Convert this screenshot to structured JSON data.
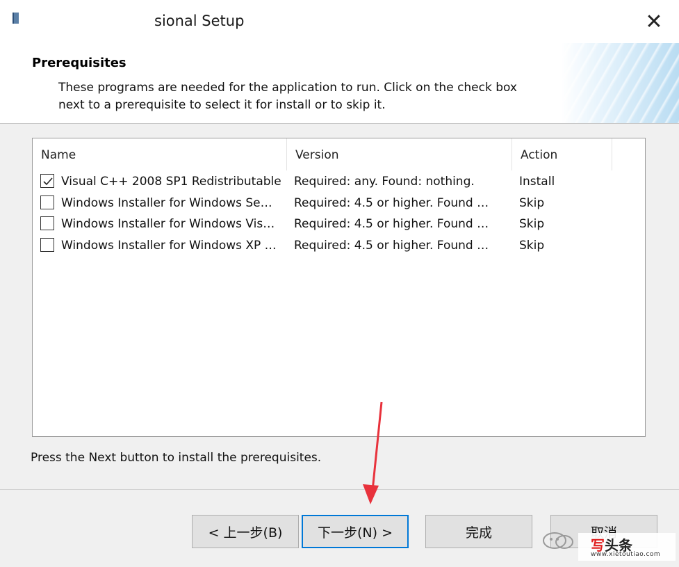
{
  "window": {
    "title": "sional Setup",
    "close_label": "✕"
  },
  "header": {
    "title": "Prerequisites",
    "description_line1": "These programs are needed for the application to run. Click on the check box",
    "description_line2": "next to a prerequisite to select it for install or to skip it."
  },
  "list": {
    "columns": [
      "Name",
      "Version",
      "Action"
    ],
    "rows": [
      {
        "checked": true,
        "name": "Visual C++ 2008 SP1 Redistributable",
        "version": "Required: any. Found: nothing.",
        "action": "Install"
      },
      {
        "checked": false,
        "name": "Windows Installer for Windows Se…",
        "version": "Required: 4.5 or higher. Found …",
        "action": "Skip"
      },
      {
        "checked": false,
        "name": "Windows Installer for Windows Vis…",
        "version": "Required: 4.5 or higher. Found …",
        "action": "Skip"
      },
      {
        "checked": false,
        "name": "Windows Installer for Windows XP …",
        "version": "Required: 4.5 or higher. Found …",
        "action": "Skip"
      }
    ]
  },
  "footer_text": "Press the Next button to install the prerequisites.",
  "buttons": {
    "back": "< 上一步(B)",
    "next": "下一步(N) >",
    "finish": "完成",
    "cancel": "取消"
  },
  "watermark": {
    "brand_red": "写",
    "brand_rest": "头条",
    "url": "www.xietoutiao.com"
  },
  "colors": {
    "accent": "#0078d7",
    "annotation_arrow": "#e8323c"
  }
}
